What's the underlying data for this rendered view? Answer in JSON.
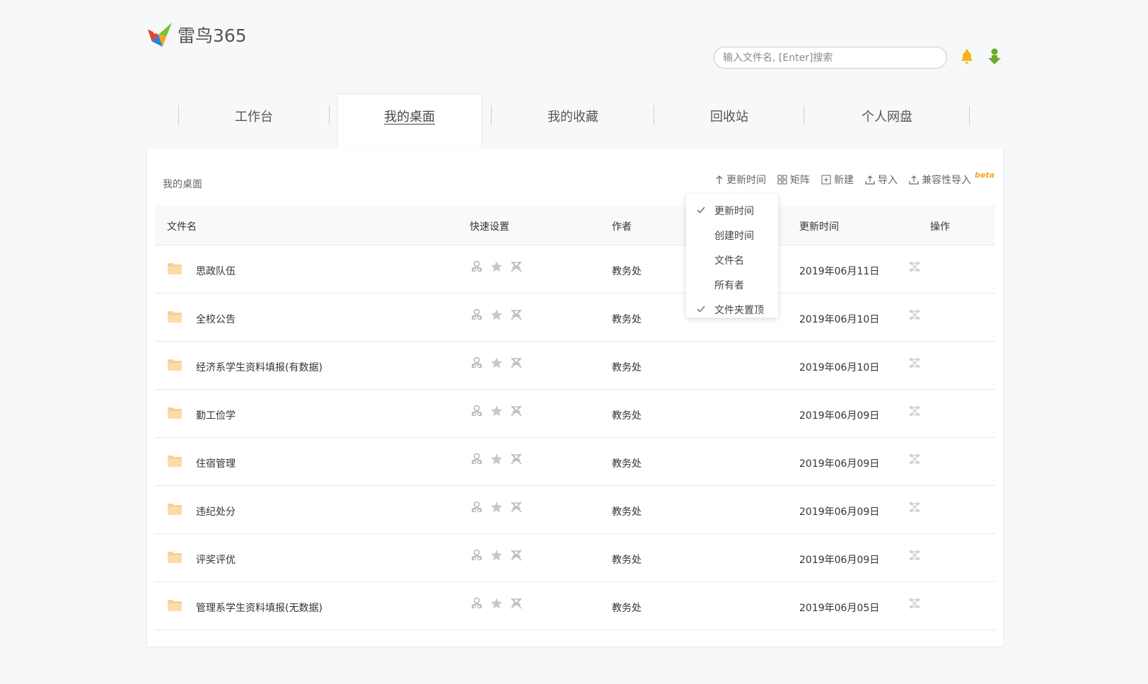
{
  "header": {
    "logo_text": "雷鸟365",
    "search_placeholder": "输入文件名, [Enter]搜索"
  },
  "nav": {
    "tabs": [
      {
        "label": "工作台"
      },
      {
        "label": "我的桌面"
      },
      {
        "label": "我的收藏"
      },
      {
        "label": "回收站"
      },
      {
        "label": "个人网盘"
      }
    ],
    "active_index": 1
  },
  "panel": {
    "title": "我的桌面",
    "toolbar": {
      "sort": "更新时间",
      "matrix": "矩阵",
      "new": "新建",
      "import": "导入",
      "compat_import": "兼容性导入",
      "beta": "beta"
    }
  },
  "sort_menu": {
    "items": [
      {
        "label": "更新时间",
        "checked": true
      },
      {
        "label": "创建时间",
        "checked": false
      },
      {
        "label": "文件名",
        "checked": false
      },
      {
        "label": "所有者",
        "checked": false
      },
      {
        "label": "文件夹置顶",
        "checked": true
      }
    ]
  },
  "table": {
    "headers": {
      "name": "文件名",
      "quick": "快速设置",
      "author": "作者",
      "updated": "更新时间",
      "ops": "操作"
    },
    "rows": [
      {
        "name": "思政队伍",
        "author": "教务处",
        "updated": "2019年06月11日"
      },
      {
        "name": "全校公告",
        "author": "教务处",
        "updated": "2019年06月10日"
      },
      {
        "name": "经济系学生资料填报(有数据)",
        "author": "教务处",
        "updated": "2019年06月10日"
      },
      {
        "name": "勤工俭学",
        "author": "教务处",
        "updated": "2019年06月09日"
      },
      {
        "name": "住宿管理",
        "author": "教务处",
        "updated": "2019年06月09日"
      },
      {
        "name": "违纪处分",
        "author": "教务处",
        "updated": "2019年06月09日"
      },
      {
        "name": "评奖评优",
        "author": "教务处",
        "updated": "2019年06月09日"
      },
      {
        "name": "管理系学生资料填报(无数据)",
        "author": "教务处",
        "updated": "2019年06月05日"
      }
    ]
  },
  "colors": {
    "folder": "#f9d08f",
    "bell": "#f5b21a",
    "user_icon": "#6aaa2a",
    "quick_icon": "#b5b5b5"
  }
}
